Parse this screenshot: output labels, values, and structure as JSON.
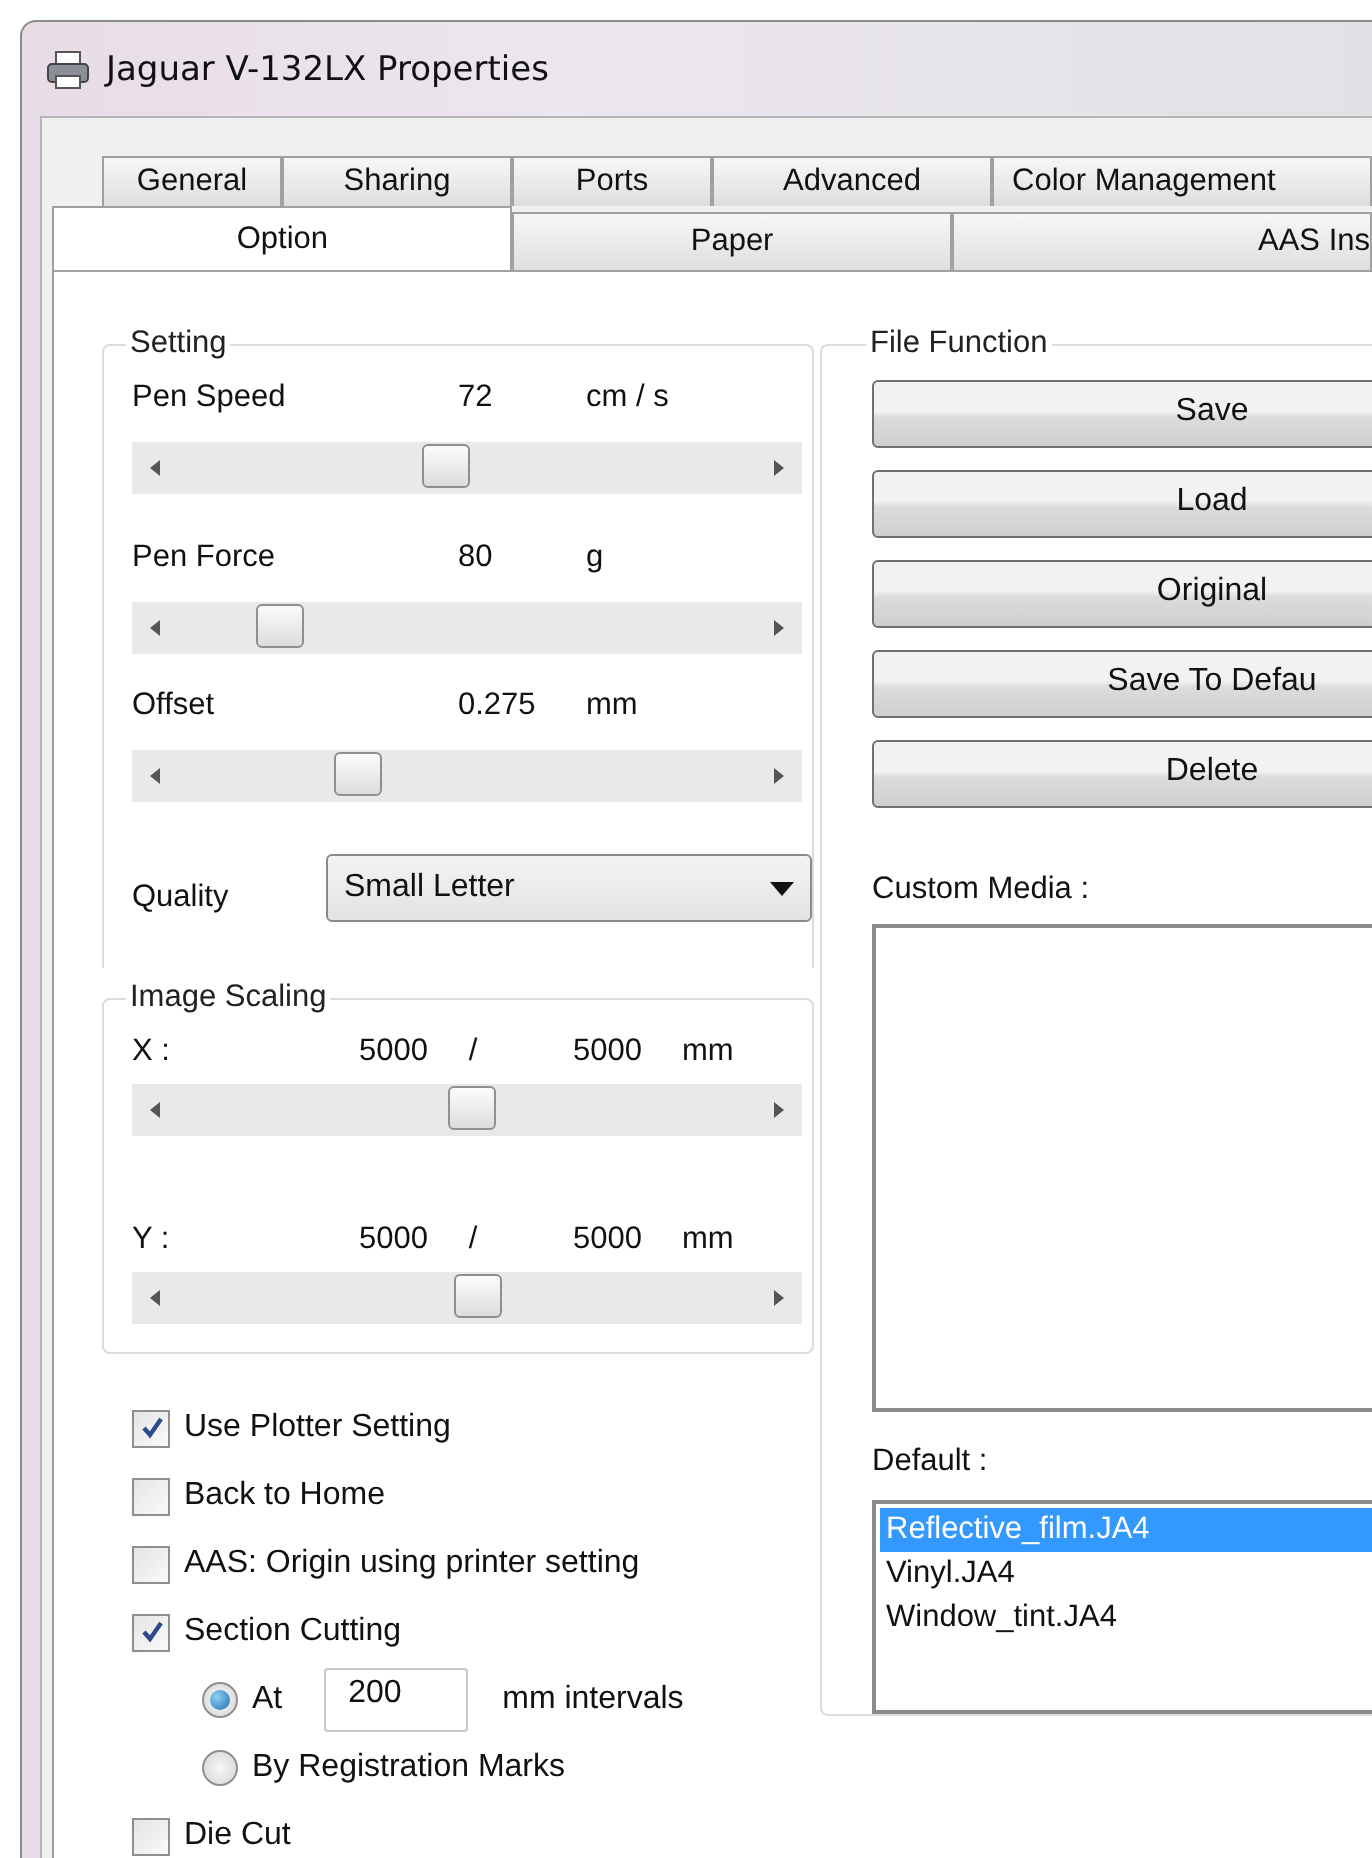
{
  "window": {
    "title": "Jaguar V-132LX Properties"
  },
  "tabs_row_1": [
    {
      "label": "General",
      "selected": false
    },
    {
      "label": "Sharing",
      "selected": false
    },
    {
      "label": "Ports",
      "selected": false
    },
    {
      "label": "Advanced",
      "selected": false
    },
    {
      "label": "Color Management",
      "selected": false
    }
  ],
  "tabs_row_2": [
    {
      "label": "Option",
      "selected": true
    },
    {
      "label": "Paper",
      "selected": false
    },
    {
      "label": "AAS Ins",
      "selected": false
    }
  ],
  "setting": {
    "title": "Setting",
    "sliders": [
      {
        "label": "Pen Speed",
        "value": "72",
        "unit": "cm / s",
        "level": 0.46
      },
      {
        "label": "Pen Force",
        "value": "80",
        "unit": "g",
        "level": 0.16
      },
      {
        "label": "Offset",
        "value": "0.275",
        "unit": "mm",
        "level": 0.3
      }
    ],
    "quality": {
      "label": "Quality",
      "value": "Small Letter"
    }
  },
  "image_scaling": {
    "title": "Image Scaling",
    "rows": [
      {
        "axis": "X :",
        "value": "5000",
        "separator": "/",
        "total": "5000",
        "unit": "mm",
        "level": 0.51
      },
      {
        "axis": "Y :",
        "value": "5000",
        "separator": "/",
        "total": "5000",
        "unit": "mm",
        "level": 0.52
      }
    ]
  },
  "options": [
    {
      "kind": "checkbox",
      "label": "Use Plotter Setting",
      "checked": true
    },
    {
      "kind": "checkbox",
      "label": "Back to Home",
      "checked": false
    },
    {
      "kind": "checkbox",
      "label": "AAS: Origin using printer setting",
      "checked": false
    },
    {
      "kind": "checkbox",
      "label": "Section Cutting",
      "checked": true
    },
    {
      "kind": "radio",
      "label": "At",
      "selected": true,
      "field": "200",
      "suffix": "mm intervals"
    },
    {
      "kind": "radio",
      "label": "By Registration Marks",
      "selected": false
    },
    {
      "kind": "checkbox",
      "label": "Die Cut",
      "checked": false
    }
  ],
  "file_function": {
    "title": "File Function",
    "buttons": [
      "Save",
      "Load",
      "Original",
      "Save To Defau",
      "Delete"
    ],
    "custom_media_label": "Custom Media :",
    "default_label": "Default :",
    "default_items": [
      {
        "label": "Reflective_film.JA4",
        "selected": true
      },
      {
        "label": "Vinyl.JA4",
        "selected": false
      },
      {
        "label": "Window_tint.JA4",
        "selected": false
      }
    ]
  }
}
